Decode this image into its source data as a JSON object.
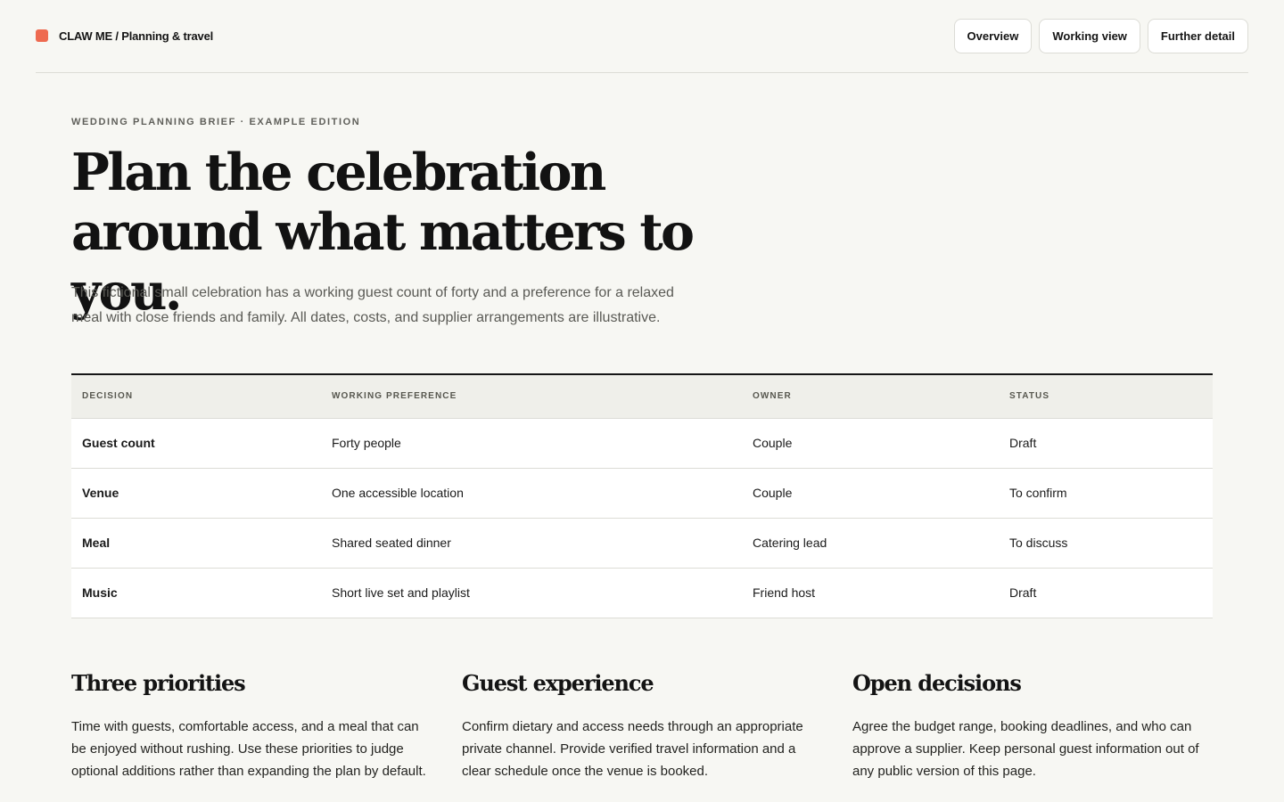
{
  "header": {
    "brand": "CLAW ME / Planning & travel",
    "nav": [
      "Overview",
      "Working view",
      "Further detail"
    ]
  },
  "hero": {
    "eyebrow": "WEDDING PLANNING BRIEF · EXAMPLE EDITION",
    "title": "Plan the celebration around what matters to you.",
    "lede": "This fictional small celebration has a working guest count of forty and a preference for a relaxed meal with close friends and family. All dates, costs, and supplier arrangements are illustrative."
  },
  "table": {
    "columns": [
      "DECISION",
      "WORKING PREFERENCE",
      "OWNER",
      "STATUS"
    ],
    "rows": [
      [
        "Guest count",
        "Forty people",
        "Couple",
        "Draft"
      ],
      [
        "Venue",
        "One accessible location",
        "Couple",
        "To confirm"
      ],
      [
        "Meal",
        "Shared seated dinner",
        "Catering lead",
        "To discuss"
      ],
      [
        "Music",
        "Short live set and playlist",
        "Friend host",
        "Draft"
      ]
    ]
  },
  "sections": [
    {
      "title": "Three priorities",
      "body": "Time with guests, comfortable access, and a meal that can be enjoyed without rushing. Use these priorities to judge optional additions rather than expanding the plan by default."
    },
    {
      "title": "Guest experience",
      "body": "Confirm dietary and access needs through an appropriate private channel. Provide verified travel information and a clear schedule once the venue is booked."
    },
    {
      "title": "Open decisions",
      "body": "Agree the budget range, booking deadlines, and who can approve a supplier. Keep personal guest information out of any public version of this page."
    }
  ],
  "colors": {
    "background": "#f7f7f3",
    "accent": "#ee6a50",
    "text": "#161616"
  }
}
